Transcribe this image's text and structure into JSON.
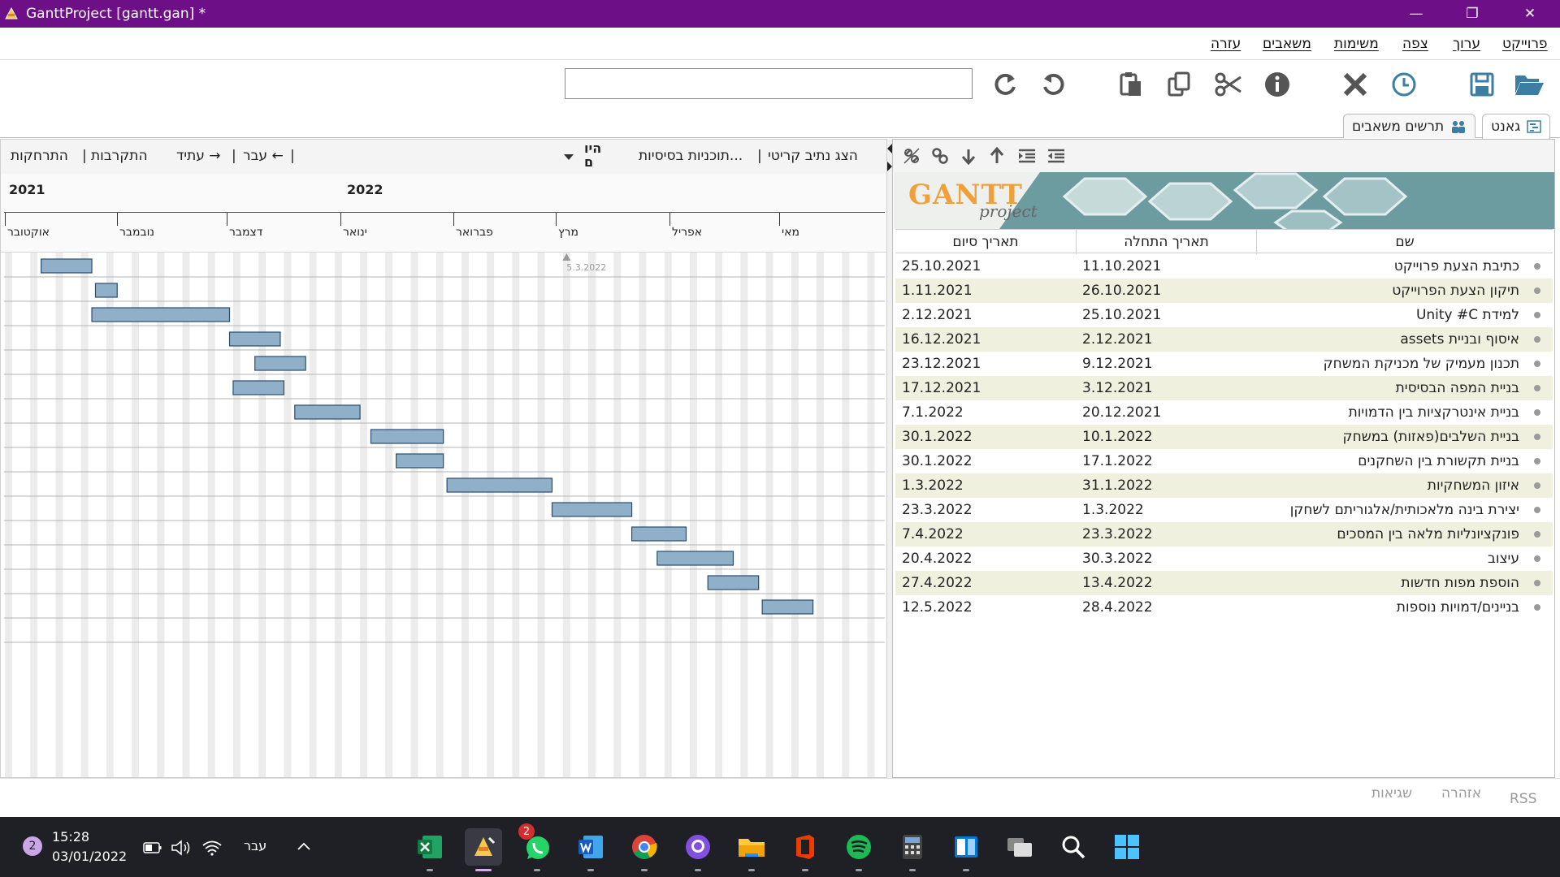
{
  "window": {
    "title": "GanttProject [gantt.gan] *",
    "controls": [
      "—",
      "❐",
      "✕"
    ]
  },
  "menu": [
    "פרוייקט",
    "ערוך",
    "צפה",
    "משימות",
    "משאבים",
    "עזרה"
  ],
  "search": {
    "value": "",
    "placeholder": ""
  },
  "tabs": [
    "גאנט",
    "תרשים משאבים"
  ],
  "chart_toolbar": {
    "critical_path": "הצג נתיב קריטי",
    "baselines": "תוכניות בסיסיות...",
    "today": "היו\nם",
    "back": "עבר ←",
    "forward": "עתיד →",
    "zoom_in": "התקרבות",
    "zoom_out": "התרחקות",
    "separator": "|"
  },
  "timeline": {
    "years": [
      "2021",
      "2022"
    ],
    "months": [
      "אוקטובר",
      "נובמבר",
      "דצמבר",
      "ינואר",
      "פברואר",
      "מרץ",
      "אפריל",
      "מאי"
    ],
    "marker_date": "5.3.2022"
  },
  "table": {
    "headers": {
      "name": "שם",
      "start": "תאריך התחלה",
      "end": "תאריך סיום"
    },
    "rows": [
      {
        "name": "כתיבת הצעת פרוייקט",
        "start": "11.10.2021",
        "end": "25.10.2021"
      },
      {
        "name": "תיקון הצעת הפרוייקט",
        "start": "26.10.2021",
        "end": "1.11.2021"
      },
      {
        "name": "למידת Unity #C",
        "start": "25.10.2021",
        "end": "2.12.2021"
      },
      {
        "name": "איסוף ובניית assets",
        "start": "2.12.2021",
        "end": "16.12.2021"
      },
      {
        "name": "תכנון מעמיק של מכניקת המשחק",
        "start": "9.12.2021",
        "end": "23.12.2021"
      },
      {
        "name": "בניית המפה הבסיסית",
        "start": "3.12.2021",
        "end": "17.12.2021"
      },
      {
        "name": "בניית אינטרקציות בין הדמויות",
        "start": "20.12.2021",
        "end": "7.1.2022"
      },
      {
        "name": "בניית השלבים(פאזות) במשחק",
        "start": "10.1.2022",
        "end": "30.1.2022"
      },
      {
        "name": "בניית תקשורת בין השחקנים",
        "start": "17.1.2022",
        "end": "30.1.2022"
      },
      {
        "name": "איזון המשחקיות",
        "start": "31.1.2022",
        "end": "1.3.2022"
      },
      {
        "name": "יצירת בינה מלאכותית/אלגוריתם לשחקן",
        "start": "1.3.2022",
        "end": "23.3.2022"
      },
      {
        "name": "פונקציונליות מלאה בין המסכים",
        "start": "23.3.2022",
        "end": "7.4.2022"
      },
      {
        "name": "עיצוב",
        "start": "30.3.2022",
        "end": "20.4.2022"
      },
      {
        "name": "הוספת מפות חדשות",
        "start": "13.4.2022",
        "end": "27.4.2022"
      },
      {
        "name": "בניינים/דמויות נוספות",
        "start": "28.4.2022",
        "end": "12.5.2022"
      }
    ]
  },
  "logo": {
    "main": "GANTT",
    "sub": "project"
  },
  "status": {
    "errors": "שגיאות",
    "warning": "אזהרה",
    "rss": "RSS"
  },
  "taskbar": {
    "notification_count": "2",
    "time": "15:28",
    "date": "03/01/2022",
    "language": "עבר",
    "whatsapp_badge": "2",
    "apps": [
      "excel",
      "ganttproject",
      "whatsapp",
      "word",
      "chrome",
      "github",
      "file-explorer",
      "office",
      "spotify",
      "calculator",
      "notepad",
      "task-view",
      "search",
      "start"
    ]
  },
  "colors": {
    "titlebar": "#6d0f86",
    "bar_fill": "#8fb0c8",
    "bar_border": "#2a4d6e",
    "row_alt": "#f0f0de"
  }
}
